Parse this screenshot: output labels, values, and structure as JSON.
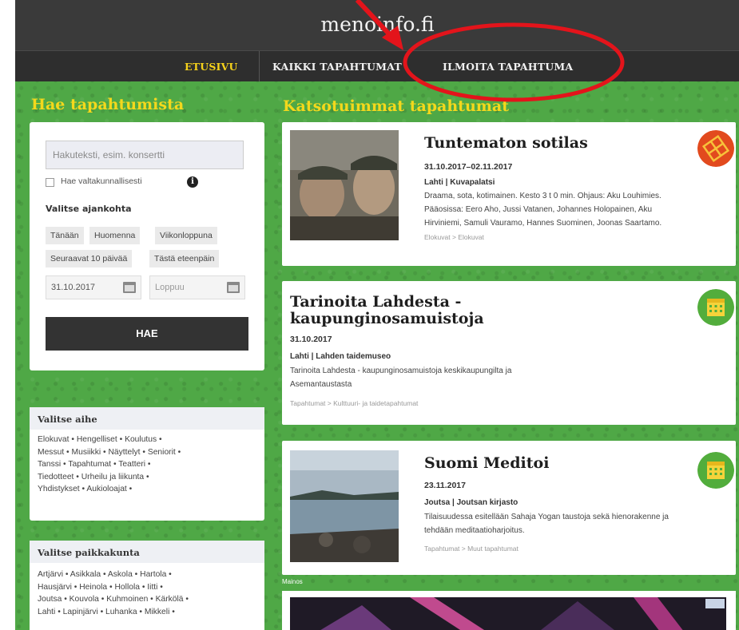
{
  "site": {
    "logo_text": "menoinfo.fi"
  },
  "nav": {
    "items": [
      "ETUSIVU",
      "KAIKKI TAPAHTUMAT",
      "ILMOITA TAPAHTUMA"
    ]
  },
  "search": {
    "title": "Hae tapahtumista",
    "placeholder": "Hakuteksti, esim. konsertti",
    "national_label": "Hae valtakunnallisesti",
    "time_label": "Valitse ajankohta",
    "quick_times": [
      "Tänään",
      "Huomenna",
      "Viikonloppuna",
      "Seuraavat 10 päivää",
      "Tästä eteenpäin"
    ],
    "start_date": "31.10.2017",
    "end_placeholder": "Loppuu",
    "button_label": "HAE"
  },
  "topics": {
    "header": "Valitse aihe",
    "lines": [
      "Elokuvat • Hengelliset • Koulutus •",
      "Messut • Musiikki • Näyttelyt • Seniorit •",
      "Tanssi • Tapahtumat • Teatteri •",
      "Tiedotteet • Urheilu ja liikunta •",
      "Yhdistykset • Aukioloajat •"
    ]
  },
  "places": {
    "header": "Valitse paikkakunta",
    "lines": [
      "Artjärvi • Asikkala • Askola • Hartola •",
      "Hausjärvi • Heinola • Hollola • Iitti •",
      "Joutsa • Kouvola • Kuhmoinen • Kärkölä •",
      "Lahti • Lapinjärvi • Luhanka • Mikkeli •"
    ]
  },
  "popular": {
    "title": "Katsotuimmat tapahtumat",
    "events": [
      {
        "title": "Tuntematon sotilas",
        "date": "31.10.2017–02.11.2017",
        "venue": "Lahti | Kuvapalatsi",
        "desc": [
          "Draama, sota, kotimainen. Kesto 3 t 0 min. Ohjaus: Aku Louhimies.",
          "Pääosissa: Eero Aho, Jussi Vatanen, Johannes Holopainen, Aku",
          "Hirviniemi, Samuli Vauramo, Hannes Suominen, Joonas Saartamo."
        ],
        "category": "Elokuvat > Elokuvat",
        "badge": "film-reel-icon"
      },
      {
        "title": "Tarinoita Lahdesta - kaupunginosamuistoja",
        "title_lines": [
          "Tarinoita Lahdesta -",
          "kaupunginosamuistoja"
        ],
        "date": "31.10.2017",
        "venue": "Lahti | Lahden taidemuseo",
        "desc": [
          "Tarinoita Lahdesta - kaupunginosamuistoja keskikaupungilta ja",
          "Asemantaustasta"
        ],
        "category": "Tapahtumat > Kulttuuri- ja taidetapahtumat",
        "badge": "calendar-icon"
      },
      {
        "title": "Suomi Meditoi",
        "date": "23.11.2017",
        "venue": "Joutsa | Joutsan kirjasto",
        "desc": [
          "Tilaisuudessa esitellään Sahaja Yogan taustoja sekä hienorakenne ja",
          "tehdään meditaatioharjoitus."
        ],
        "category": "Tapahtumat > Muut tapahtumat",
        "badge": "calendar-icon"
      }
    ]
  },
  "ad": {
    "label": "Mainos"
  },
  "colors": {
    "background_green": "#4fa846",
    "header_dark": "#3a3a3a",
    "accent_yellow": "#f4d81c",
    "annotation_red": "#e3141b"
  }
}
